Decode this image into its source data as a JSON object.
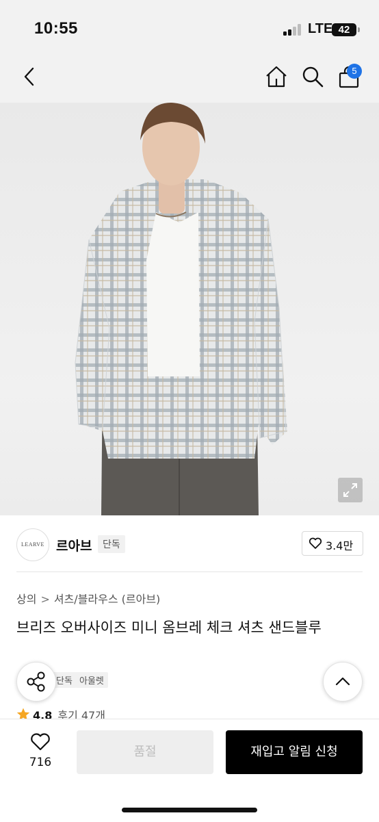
{
  "status_bar": {
    "time": "10:55",
    "network": "LTE",
    "battery": "42"
  },
  "nav": {
    "back_icon": "chevron-left-icon",
    "home_icon": "home-icon",
    "search_icon": "search-icon",
    "cart_icon": "shopping-bag-icon",
    "cart_count": "5"
  },
  "image": {
    "expand_icon": "expand-icon"
  },
  "brand": {
    "logo_text": "LEARVE",
    "name": "르아브",
    "badge": "단독",
    "like_count": "3.4만"
  },
  "product": {
    "breadcrumb": [
      "상의",
      "셔츠/블라우스 (르아브)"
    ],
    "title": "브리즈 오버사이즈 미니 옴브레 체크 셔츠 샌드블루",
    "tags": [
      "단독",
      "아울렛"
    ],
    "rating": "4.8",
    "review_label": "후기 47개"
  },
  "floating": {
    "share_icon": "share-icon",
    "scroll_top_icon": "chevron-up-icon"
  },
  "bottom_bar": {
    "wish_count": "716",
    "soldout_label": "품절",
    "restock_label": "재입고 알림 신청"
  },
  "colors": {
    "accent": "#1f73e6",
    "star": "#f5a623",
    "cta": "#000000"
  }
}
